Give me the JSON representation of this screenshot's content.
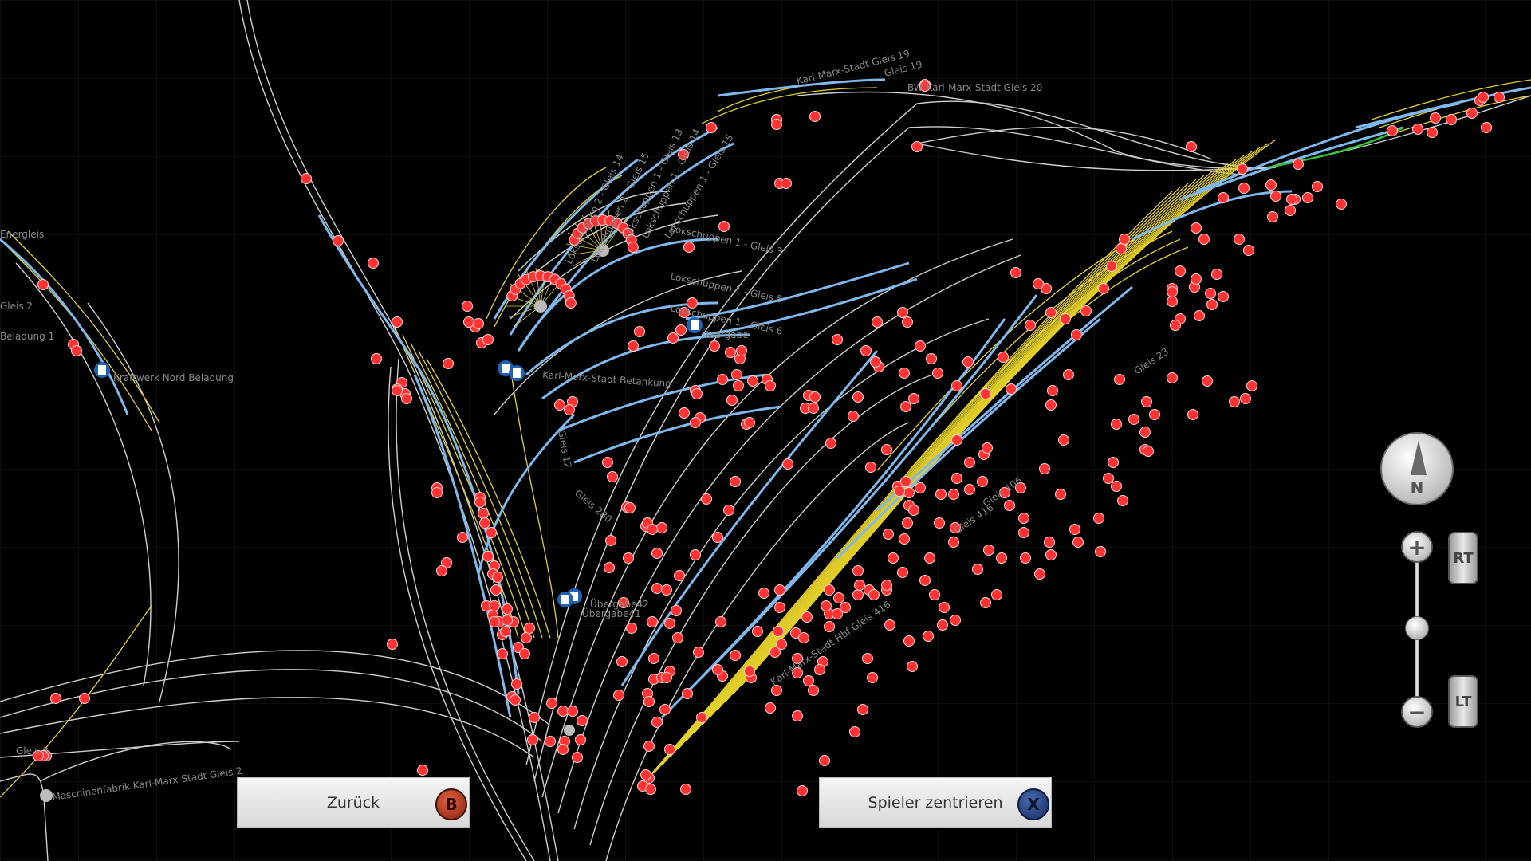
{
  "map": {
    "colors": {
      "background": "#000000",
      "grid": "#1c1c1c",
      "track_white": "#cfcfcf",
      "track_yellow": "#e6d22a",
      "track_blue": "#7fb8ec",
      "track_green": "#36c43a",
      "signal_red": "#ff3333",
      "station_blue": "#1f62b5"
    },
    "labels": [
      {
        "text": "BW Karl-Marx-Stadt Gleis 20"
      },
      {
        "text": "Karl-Marx-Stadt Gleis 19"
      },
      {
        "text": "Gleis 19"
      },
      {
        "text": "Lokschuppen 2 - Gleis 14"
      },
      {
        "text": "Lokschuppen 2 - Gleis 15"
      },
      {
        "text": "Lokschuppen 1 - Gleis 13"
      },
      {
        "text": "Lokschuppen 1 - Gleis 14"
      },
      {
        "text": "Lokschuppen 1 - Gleis 15"
      },
      {
        "text": "Lokschuppen 1 - Gleis 3"
      },
      {
        "text": "Lokschuppen 1 - Gleis 5"
      },
      {
        "text": "Lokschuppen 1 - Gleis 6"
      },
      {
        "text": "Übergabe"
      },
      {
        "text": "Karl-Marx-Stadt Betankung"
      },
      {
        "text": "Gleis 12"
      },
      {
        "text": "Gleis 280"
      },
      {
        "text": "Übergabe42"
      },
      {
        "text": "Übergabe41"
      },
      {
        "text": "Kraftwerk Nord Beladung"
      },
      {
        "text": "Energleis"
      },
      {
        "text": "Beladung 1"
      },
      {
        "text": "Gleis 2"
      },
      {
        "text": "Gleis 3"
      },
      {
        "text": "Maschinenfabrik Karl-Marx-Stadt Gleis 2"
      },
      {
        "text": "Karl-Marx-Stadt Hbf Gleis 416"
      },
      {
        "text": "Gleis 106"
      },
      {
        "text": "Gleis 23"
      },
      {
        "text": "Gleis 416"
      }
    ]
  },
  "buttons": {
    "back": {
      "label": "Zurück",
      "badge": "B"
    },
    "center": {
      "label": "Spieler zentrieren",
      "badge": "X"
    }
  },
  "controls": {
    "compass": "N",
    "zoom_in": "+",
    "zoom_out": "−",
    "trigger_right": "RT",
    "trigger_left": "LT",
    "icons": {
      "compass": "compass-icon",
      "zoom_in": "plus-icon",
      "zoom_out": "minus-icon"
    }
  }
}
